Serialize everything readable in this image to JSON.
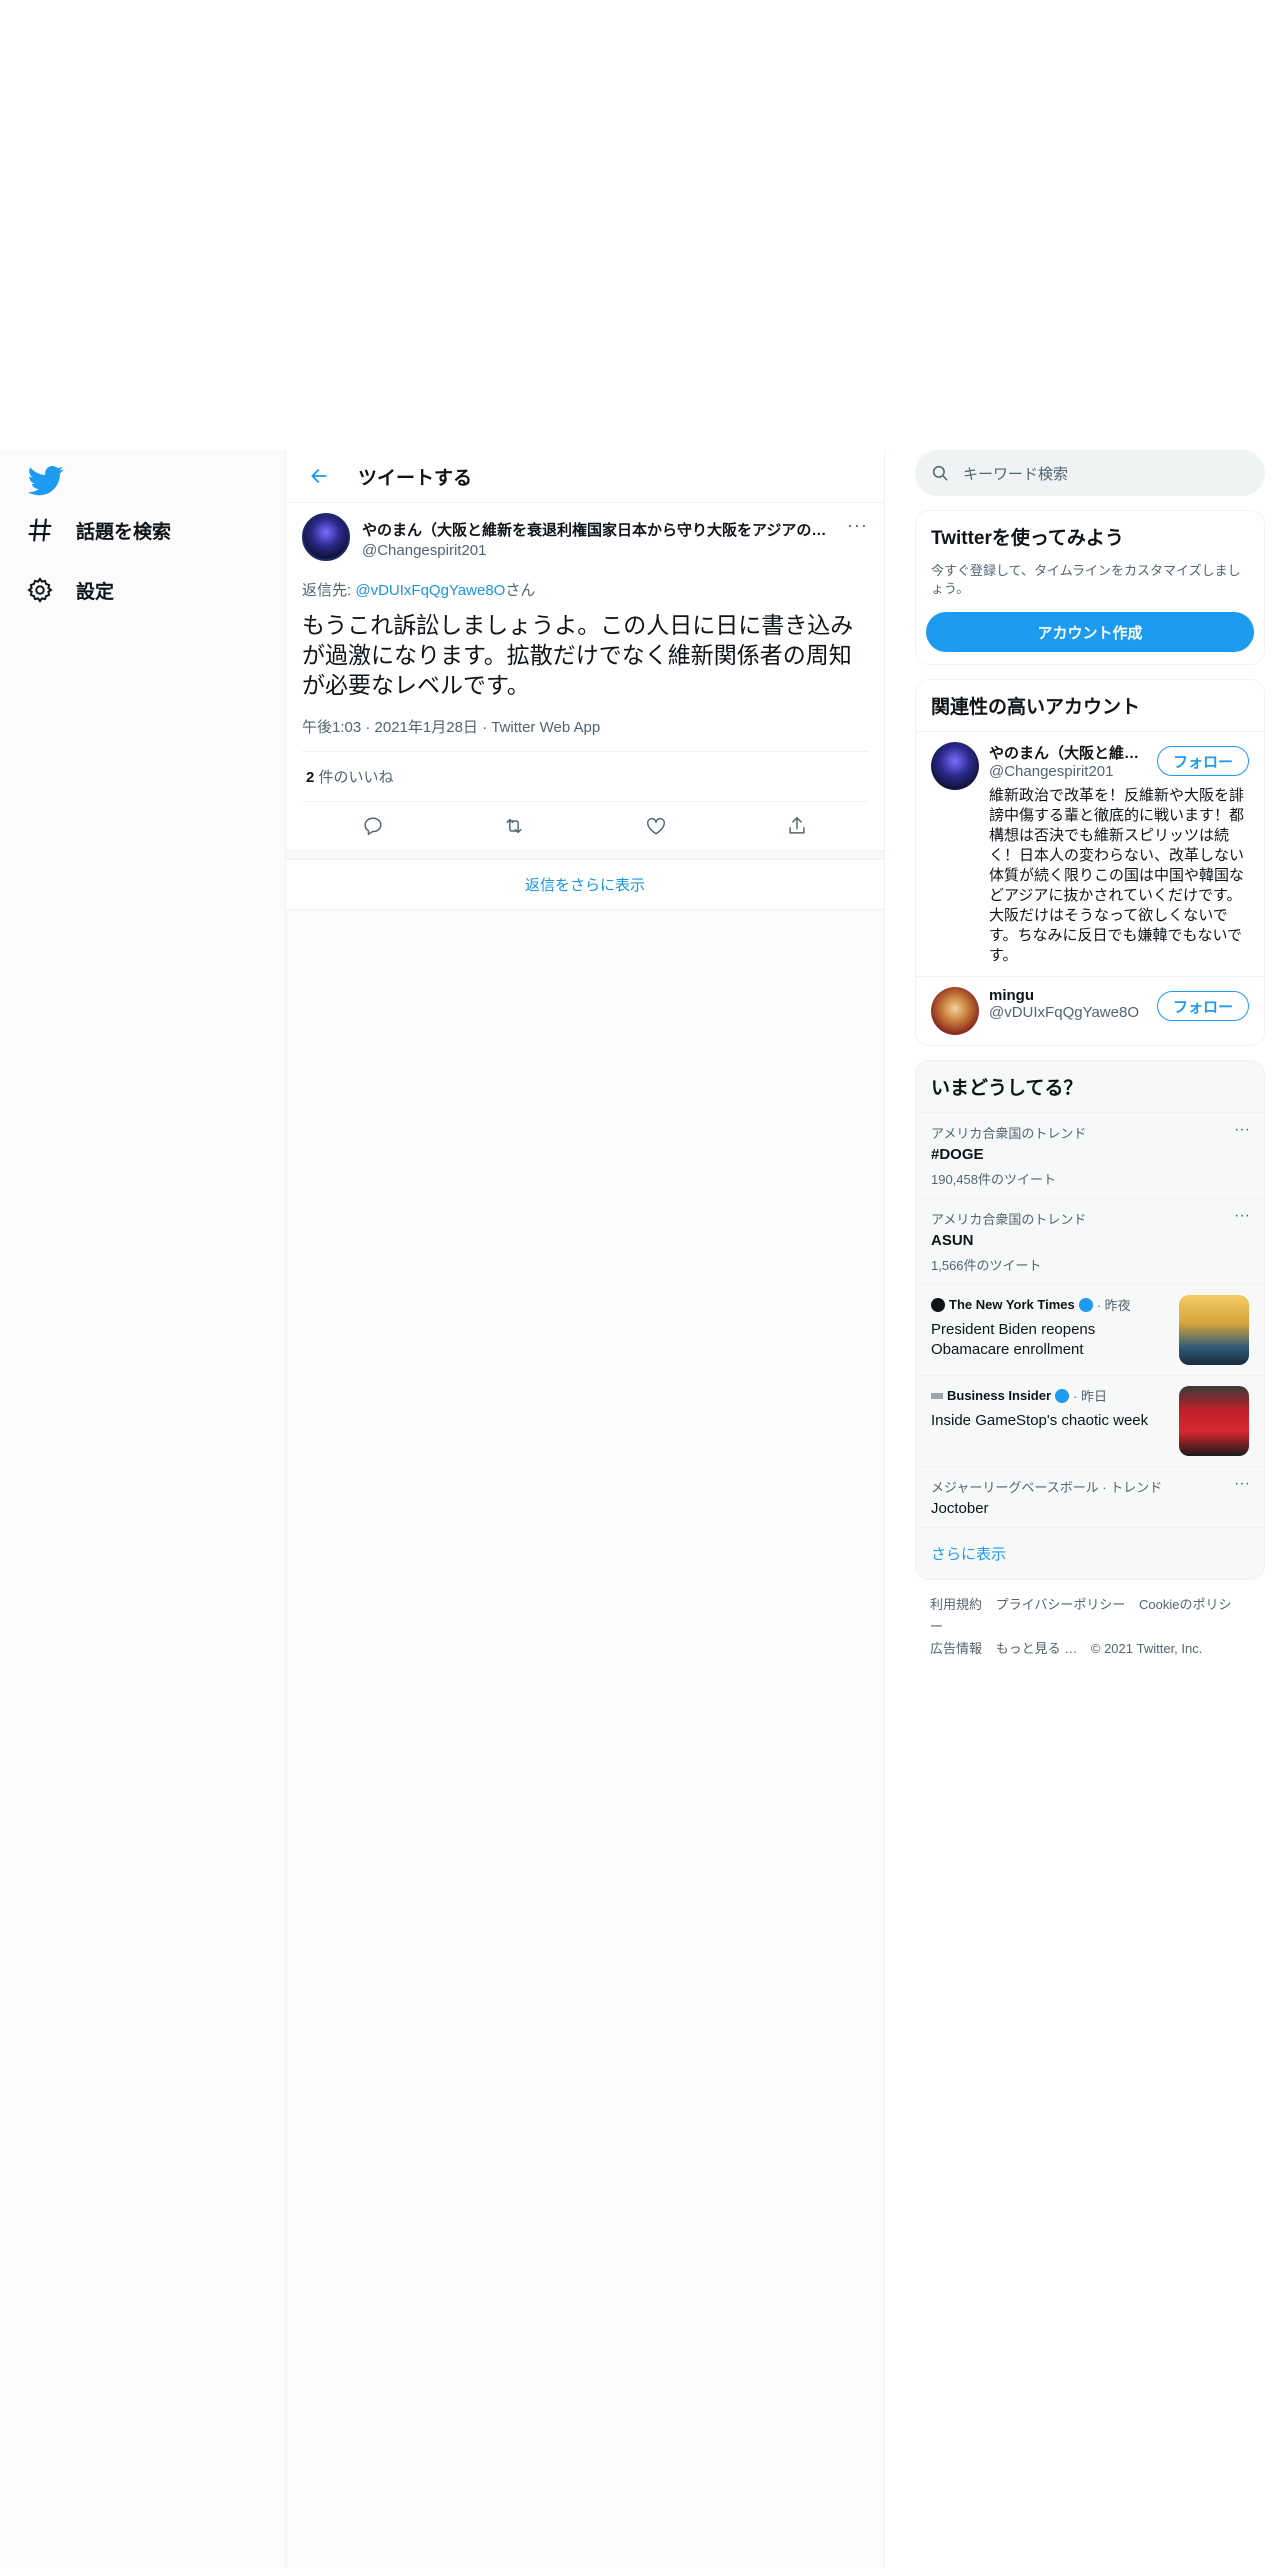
{
  "nav": {
    "explore_label": "話題を検索",
    "settings_label": "設定"
  },
  "header": {
    "title": "ツイートする"
  },
  "tweet": {
    "author_name": "やのまん（大阪と維新を衰退利権国家日本から守り大阪をアジアの…",
    "author_handle": "@Changespirit201",
    "more": "···",
    "reply_prefix": "返信先: ",
    "reply_mention": "@vDUIxFqQgYawe8O",
    "reply_suffix": "さん",
    "text": "もうこれ訴訟しましょうよ。この人日に日に書き込みが過激になります。拡散だけでなく維新関係者の周知が必要なレベルです。",
    "meta": "午後1:03 · 2021年1月28日 · Twitter Web App",
    "likes_count": "2",
    "likes_label": " 件のいいね"
  },
  "show_more_replies": "返信をさらに表示",
  "sidebar": {
    "search_placeholder": "キーワード検索",
    "signup": {
      "title": "Twitterを使ってみよう",
      "subtitle": "今すぐ登録して、タイムラインをカスタマイズしましょう。",
      "button": "アカウント作成"
    },
    "relevant": {
      "title": "関連性の高いアカウント",
      "accounts": [
        {
          "name": "やのまん（大阪と維…",
          "handle": "@Changespirit201",
          "bio": "維新政治で改革を！反維新や大阪を誹謗中傷する輩と徹底的に戦います！都構想は否決でも維新スピリッツは続く！日本人の変わらない、改革しない体質が続く限りこの国は中国や韓国などアジアに抜かされていくだけです。大阪だけはそうなって欲しくないです。ちなみに反日でも嫌韓でもないです。",
          "follow": "フォロー"
        },
        {
          "name": "mingu",
          "handle": "@vDUIxFqQgYawe8O",
          "bio": "",
          "follow": "フォロー"
        }
      ]
    },
    "trends": {
      "title": "いまどうしてる？",
      "items": [
        {
          "context": "アメリカ合衆国のトレンド",
          "name": "#DOGE",
          "count": "190,458件のツイート"
        },
        {
          "context": "アメリカ合衆国のトレンド",
          "name": "ASUN",
          "count": "1,566件のツイート"
        }
      ],
      "news": [
        {
          "source": "The New York Times",
          "time": "· 昨夜",
          "title": "President Biden reopens Obamacare enrollment"
        },
        {
          "source": "Business Insider",
          "time": "· 昨日",
          "title": "Inside GameStop's chaotic week"
        }
      ],
      "last": {
        "context": "メジャーリーグベースボール · トレンド",
        "name": "Joctober"
      },
      "show_more": "さらに表示"
    },
    "footer": {
      "links": [
        "利用規約",
        "プライバシーポリシー",
        "Cookieのポリシー",
        "広告情報",
        "もっと見る …",
        "© 2021 Twitter, Inc."
      ]
    }
  },
  "colors": {
    "accent": "#1d9bf0",
    "link": "#1b95e0",
    "muted": "#536471"
  }
}
